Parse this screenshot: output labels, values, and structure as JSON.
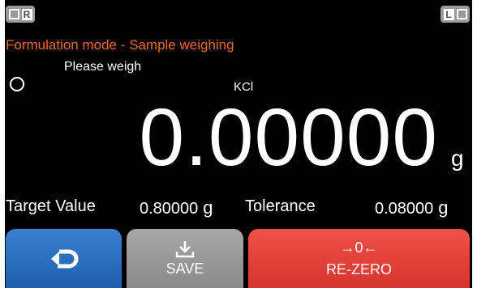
{
  "status_bar": {
    "left_badge_letter": "R",
    "right_badge_letter": "L"
  },
  "mode_title": "Formulation mode - Sample weighing",
  "prompt": "Please weigh",
  "sample_name": "KCl",
  "weight": {
    "value": "0.00000",
    "unit": "g"
  },
  "target": {
    "label": "Target Value",
    "value": "0.80000",
    "unit": "g"
  },
  "tolerance": {
    "label": "Tolerance",
    "value": "0.08000",
    "unit": "g"
  },
  "buttons": {
    "save_label": "SAVE",
    "rezero_label": "RE-ZERO",
    "rezero_icon_text": "→0←"
  },
  "colors": {
    "title_orange": "#ee6a2a",
    "back_blue": "#2a6fc0",
    "save_gray": "#999999",
    "rezero_red": "#e4423b"
  }
}
